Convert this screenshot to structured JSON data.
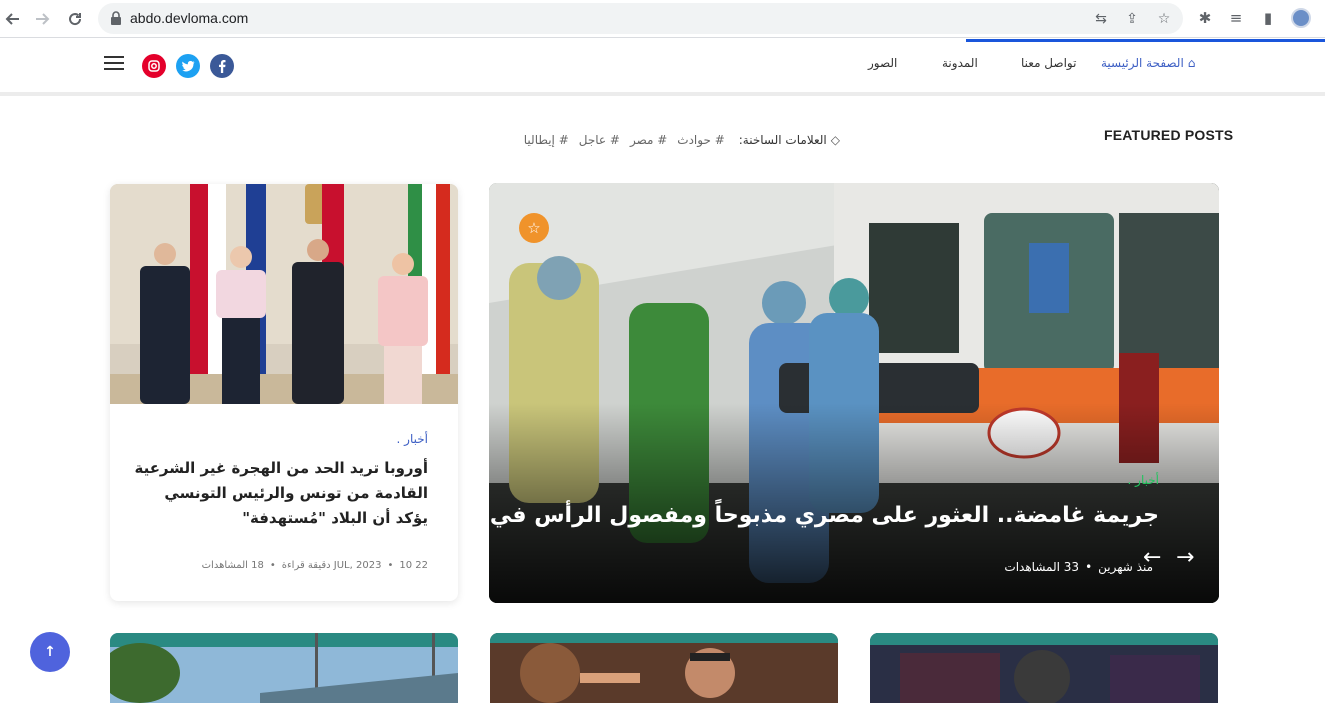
{
  "browser": {
    "url": "abdo.devloma.com"
  },
  "header": {
    "nav": [
      {
        "label": "الصفحة الرئيسية"
      },
      {
        "label": "تواصل معنا"
      },
      {
        "label": "المدونة"
      },
      {
        "label": "الصور"
      }
    ],
    "social": [
      {
        "name": "facebook",
        "glyph": "f",
        "color": "#3b5998"
      },
      {
        "name": "twitter",
        "glyph": "t",
        "color": "#1da1f2"
      },
      {
        "name": "instagram",
        "glyph": "◙",
        "color": "#e4002b"
      }
    ]
  },
  "featured": {
    "title": "FEATURED POSTS",
    "tags_label": "العلامات الساخنة:",
    "tags": [
      "# حوادث",
      "# مصر",
      "# عاجل",
      "# إيطاليا"
    ]
  },
  "hero": {
    "category": "أخبار .",
    "title": "جريمة غامضة.. العثور على مصري مذبوحاً ومفصول الرأس في إيطاليا",
    "time": "منذ شهرين",
    "views": "33 المشاهدات",
    "prev_glyph": "←",
    "next_glyph": "→"
  },
  "side_post": {
    "category": "أخبار .",
    "title": "أوروبا تريد الحد من الهجرة غير الشرعية القادمة من تونس والرئيس التونسي يؤكد أن البلاد \"مُستهدفة\"",
    "date": "22 JUL, 2023",
    "read_time": "10 دقيقة قراءة",
    "views": "18 المشاهدات"
  },
  "scroll_top": {
    "glyph": "↑"
  }
}
